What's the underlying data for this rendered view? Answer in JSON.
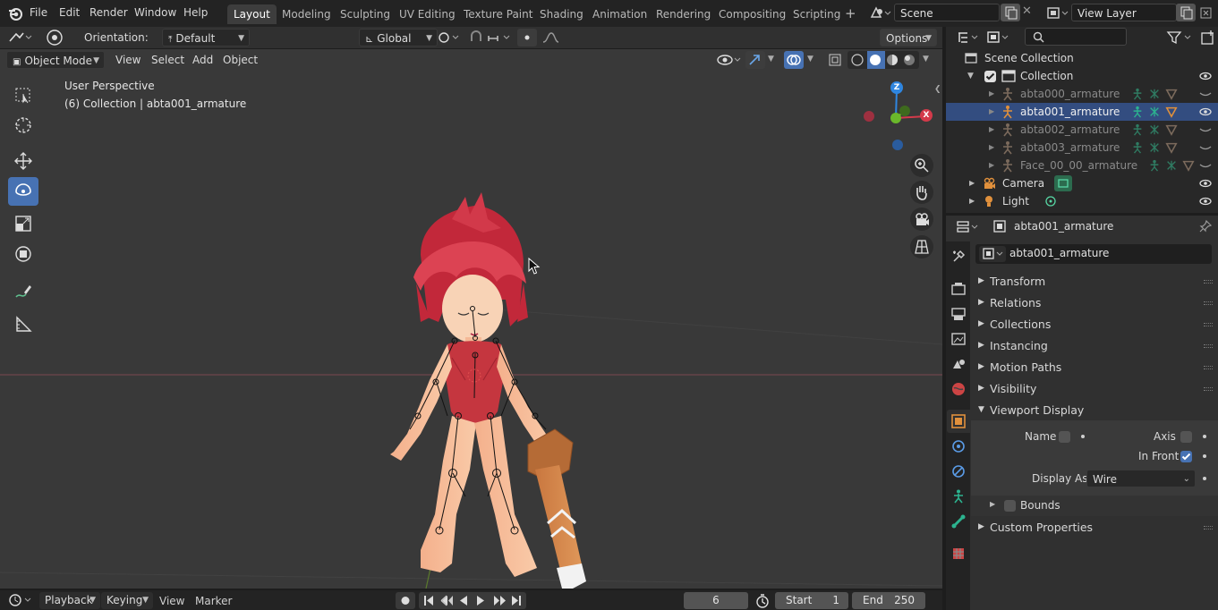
{
  "menu": {
    "items": [
      "File",
      "Edit",
      "Render",
      "Window",
      "Help"
    ]
  },
  "workspaces": {
    "tabs": [
      "Layout",
      "Modeling",
      "Sculpting",
      "UV Editing",
      "Texture Paint",
      "Shading",
      "Animation",
      "Rendering",
      "Compositing",
      "Scripting"
    ],
    "active": "Layout"
  },
  "scene": {
    "name": "Scene",
    "view_layer": "View Layer"
  },
  "tool_header": {
    "orientation_label": "Orientation:",
    "orientation_value": "Default",
    "transform_orientation": "Global",
    "options_label": "Options"
  },
  "viewport_header": {
    "mode": "Object Mode",
    "menus": [
      "View",
      "Select",
      "Add",
      "Object"
    ]
  },
  "viewport": {
    "perspective_label": "User Perspective",
    "collection_label": "(6) Collection | abta001_armature",
    "gizmo_axes": {
      "z": "Z",
      "x": "X"
    }
  },
  "timeline": {
    "menus": [
      "Playback",
      "Keying",
      "View",
      "Marker"
    ],
    "current_frame": "6",
    "start_label": "Start",
    "start_value": "1",
    "end_label": "End",
    "end_value": "250"
  },
  "outliner": {
    "root": "Scene Collection",
    "collection": "Collection",
    "items": [
      {
        "name": "abta000_armature",
        "selected": false,
        "dim": true
      },
      {
        "name": "abta001_armature",
        "selected": true,
        "dim": false
      },
      {
        "name": "abta002_armature",
        "selected": false,
        "dim": true
      },
      {
        "name": "abta003_armature",
        "selected": false,
        "dim": true
      },
      {
        "name": "Face_00_00_armature",
        "selected": false,
        "dim": true
      }
    ],
    "camera": "Camera",
    "light": "Light"
  },
  "properties": {
    "header_object": "abta001_armature",
    "object_name": "abta001_armature",
    "panels": [
      "Transform",
      "Relations",
      "Collections",
      "Instancing",
      "Motion Paths",
      "Visibility"
    ],
    "viewport_display": {
      "title": "Viewport Display",
      "name_label": "Name",
      "axis_label": "Axis",
      "in_front_label": "In Front",
      "in_front_checked": true,
      "display_as_label": "Display As",
      "display_as_value": "Wire",
      "bounds_label": "Bounds"
    },
    "custom_properties": "Custom Properties"
  },
  "colors": {
    "accent_blue": "#4772b3",
    "selection_row": "#334d80",
    "axis_x_red": "#d43a4a",
    "axis_y_green": "#6bb82b",
    "axis_z_blue": "#2f86e0",
    "armature_teal": "#2cb38f",
    "object_orange": "#e0903c"
  }
}
